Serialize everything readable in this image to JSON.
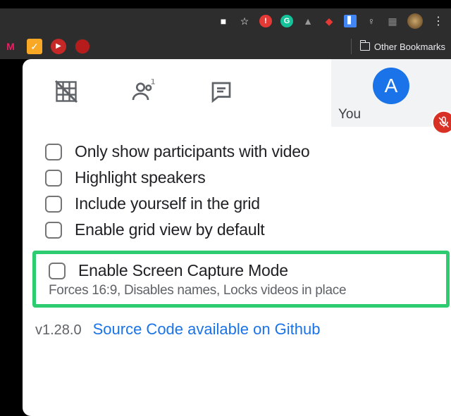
{
  "browser": {
    "other_bookmarks": "Other Bookmarks"
  },
  "meet": {
    "self_label": "You",
    "avatar_initial": "A",
    "options": [
      "Only show participants with video",
      "Highlight speakers",
      "Include yourself in the grid",
      "Enable grid view by default"
    ],
    "highlighted_option": {
      "label": "Enable Screen Capture Mode",
      "description": "Forces 16:9, Disables names, Locks videos in place"
    },
    "version": "v1.28.0",
    "source_link": "Source Code available on Github"
  }
}
